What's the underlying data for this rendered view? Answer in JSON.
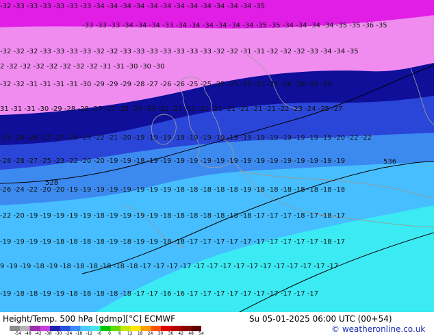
{
  "footer": {
    "title": "Height/Temp. 500 hPa [gdmp][°C] ECMWF",
    "valid_time": "Su 05-01-2025 06:00 UTC (00+54)",
    "credit": "© weatheronline.co.uk"
  },
  "colorbar": {
    "ticks": [
      "-54",
      "-48",
      "-42",
      "-38",
      "-30",
      "-24",
      "-18",
      "-12",
      "-6",
      "0",
      "6",
      "12",
      "18",
      "24",
      "30",
      "36",
      "42",
      "48",
      "54"
    ],
    "colors": [
      "#8c8c8c",
      "#b4b4b4",
      "#9d2fae",
      "#c83cdc",
      "#1e1eb4",
      "#2850dc",
      "#3c8cff",
      "#4ec8ff",
      "#46e6e6",
      "#00c800",
      "#64dc00",
      "#c8e600",
      "#ffe600",
      "#ffa000",
      "#ff5000",
      "#dc0000",
      "#b40000",
      "#8c0000",
      "#640000"
    ]
  },
  "map_colors": {
    "magenta": "#e01ee6",
    "pink": "#f08cf0",
    "navy": "#0f0f9a",
    "blue": "#2a46d8",
    "mid_blue": "#3c8af0",
    "light_blue": "#46beff",
    "cyan": "#3ceaf4",
    "coast": "#9a9a9a",
    "contour": "#000000"
  },
  "contour_labels": [
    "528",
    "536"
  ],
  "temperature_rows": [
    {
      "text": "-32 -33 -33 -33 -33 -33 -33 -34 -34 -34 -34 -34 -34 -34 -34 -34 -34 -34 -34 -35"
    },
    {
      "text": "-33 -33 -33 -34 -34 -34 -33 -34 -34 -34 -34 -34 -34 -35 -35 -34 -34 -34 -34 -35 -35 -36 -35"
    },
    {
      "text": "-32 -32 -32 -33 -33 -33 -33 -32 -32 -33 -33 -33 -33 -33 -33 -33 -32 -32 -31 -31 -32 -32 -32 -33 -34 -34 -35"
    },
    {
      "text": "2 -32 -32 -32 -32 -32 -32 -32 -31 -31 -30 -30 -30"
    },
    {
      "text": "-32 -32 -31 -31 -31 -31 -30 -29 -29 -29 -28 -27 -26 -26 -25 -25 -25 -25 -25 -25 -25 -26 -28 -29 -29"
    },
    {
      "text": "31 -31 -31 -30 -29 -28 -28 -27 -27 -25 -24 -23 -22 -21 -21 -21 -21 -21 -21 -21 -21 -22 -23 -24 -25 -27"
    },
    {
      "text": "-29 -29 -28 -27 -27 -26 -24 -22 -21 -20 -19 -19 -19 -19 -19 -19 -19 -19 -19 -19 -19 -19 -19 -19 -19 -20 -22 -22"
    },
    {
      "text": "-28 -28 -27 -25 -23 -22 -20 -20 -19 -19 -18 -19 -19 -19 -19 -19 -19 -19 -19 -19 -19 -19 -19 -19 -19 -19"
    },
    {
      "text": "-26 -24 -22 -20 -20 -19 -19 -19 -19 -19 -19 -19 -19 -18 -18 -18 -18 -18 -19 -18 -18 -18 -18 -18 -18 -18"
    },
    {
      "text": "-22 -20 -19 -19 -19 -19 -19 -18 -19 -19 -19 -19 -18 -18 -18 -18 -18 -18 -18 -17 -17 -17 -18 -17 -18 -17"
    },
    {
      "text": "-19 -19 -19 -19 -18 -18 -18 -18 -19 -18 -19 -19 -18 -18 -17 -17 -17 -17 -17 -17 -17 -17 -17 -17 -18 -17"
    },
    {
      "text": "9 -19 -19 -18 -19 -18 -18 -18 -18 -18 -18 -17 -17 -17 -17 -17 -17 -17 -17 -17 -17 -17 -17 -17 -17 -17"
    },
    {
      "text": "-19 -18 -18 -19 -19 -18 -18 -18 -18 -18 -17 -17 -16 -16 -17 -17 -17 -17 -17 -17 -17 -17 -17 -17"
    }
  ]
}
